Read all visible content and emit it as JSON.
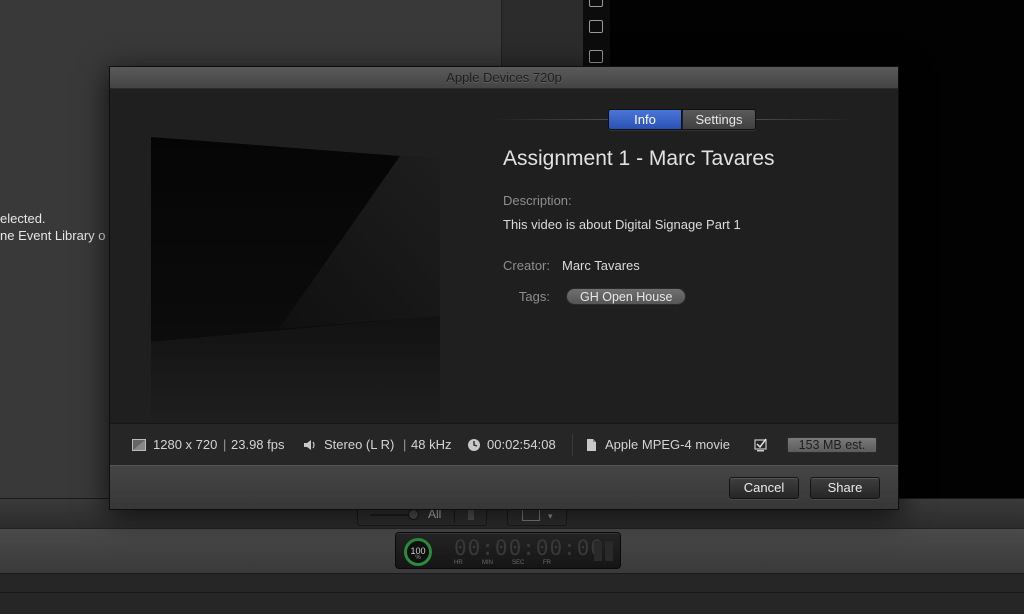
{
  "background": {
    "left_text_line1": "elected.",
    "left_text_line2": "ne Event Library o",
    "filter_label": "All"
  },
  "dialog": {
    "title": "Apple Devices 720p",
    "tabs": [
      {
        "label": "Info",
        "selected": true
      },
      {
        "label": "Settings",
        "selected": false
      }
    ],
    "meta": {
      "title": "Assignment 1 - Marc Tavares",
      "description_label": "Description:",
      "description": "This video is about Digital Signage Part 1",
      "creator_label": "Creator:",
      "creator": "Marc Tavares",
      "tags_label": "Tags:",
      "tags": [
        "GH Open House"
      ]
    },
    "info_bar": {
      "resolution": "1280 x 720",
      "fps": "23.98 fps",
      "audio": "Stereo (L R)",
      "sample_rate": "48 kHz",
      "duration": "00:02:54:08",
      "format": "Apple MPEG-4 movie",
      "size": "153 MB est."
    },
    "buttons": {
      "cancel": "Cancel",
      "share": "Share"
    }
  },
  "dashboard": {
    "gauge_value": "100",
    "gauge_unit": "%",
    "timecode": "00:00:00:00",
    "labels": [
      "HR",
      "MIN",
      "SEC",
      "FR"
    ]
  },
  "colors": {
    "accent": "#3a64c8",
    "dialog_bg": "#1f1f1f",
    "gauge": "#2e8a3c"
  }
}
